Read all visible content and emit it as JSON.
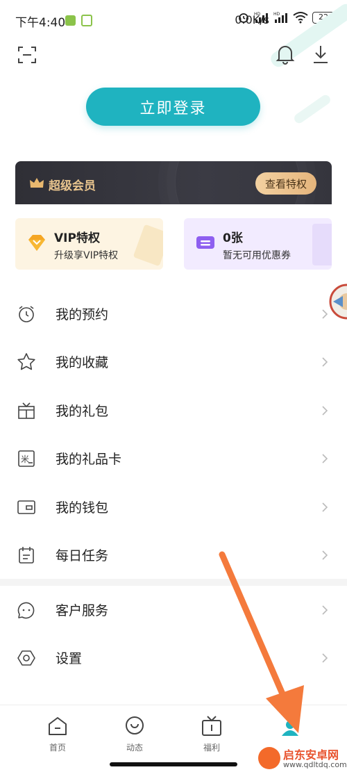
{
  "status_bar": {
    "time": "下午4:40",
    "network_speed": "0.0K/s",
    "battery": "22"
  },
  "header": {
    "login_button": "立即登录"
  },
  "vip_banner": {
    "title": "超级会员",
    "button": "查看特权",
    "accent_color": "#e8c48e"
  },
  "cards": [
    {
      "title": "VIP特权",
      "subtitle": "升级享VIP特权",
      "icon": "vip-diamond-icon"
    },
    {
      "title": "0张",
      "subtitle": "暂无可用优惠券",
      "icon": "coupon-icon"
    }
  ],
  "menu": [
    {
      "label": "我的预约",
      "icon": "alarm-clock-icon"
    },
    {
      "label": "我的收藏",
      "icon": "star-icon"
    },
    {
      "label": "我的礼包",
      "icon": "gift-box-icon"
    },
    {
      "label": "我的礼品卡",
      "icon": "gift-card-icon"
    },
    {
      "label": "我的钱包",
      "icon": "wallet-icon"
    },
    {
      "label": "每日任务",
      "icon": "calendar-task-icon"
    }
  ],
  "menu2": [
    {
      "label": "客户服务",
      "icon": "customer-service-icon"
    },
    {
      "label": "设置",
      "icon": "settings-icon"
    }
  ],
  "bottom_nav": [
    {
      "label": "首页",
      "icon": "home-icon"
    },
    {
      "label": "动态",
      "icon": "feed-icon"
    },
    {
      "label": "福利",
      "icon": "gift-tv-icon"
    },
    {
      "label": "",
      "icon": "profile-icon",
      "active": true
    }
  ],
  "colors": {
    "brand": "#1fb3c0",
    "annotation_arrow": "#f47a3c"
  },
  "watermark": {
    "name": "启东安卓网",
    "url": "www.qdltdq.com"
  }
}
